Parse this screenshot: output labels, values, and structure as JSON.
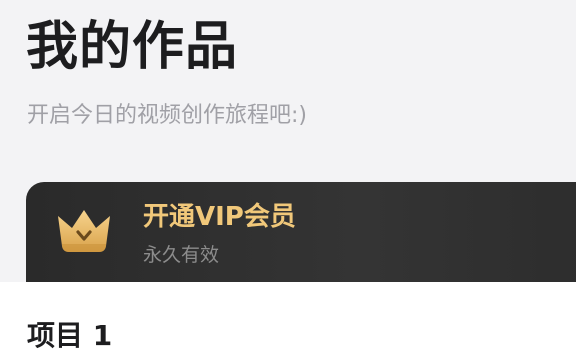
{
  "header": {
    "title": "我的作品",
    "subtitle": "开启今日的视频创作旅程吧:)"
  },
  "vip_card": {
    "title": "开通VIP会员",
    "subtitle": "永久有效",
    "icon": "crown-icon",
    "colors": {
      "card_background": "#2f2f2f",
      "title": "#f1c87a",
      "crown_gold": "#e8b458"
    }
  },
  "section": {
    "title": "项目 1"
  }
}
